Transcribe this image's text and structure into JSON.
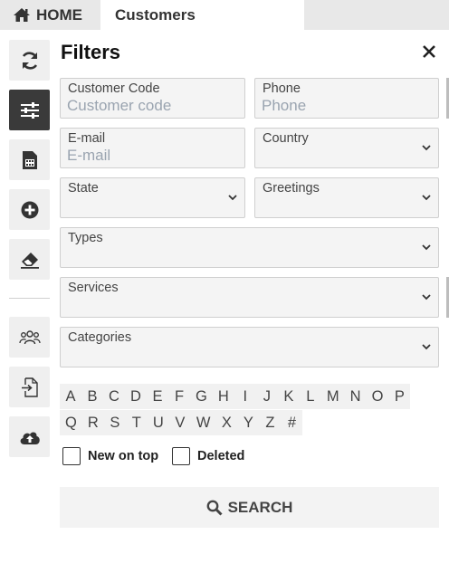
{
  "tabs": {
    "home_label": "HOME",
    "customers_label": "Customers"
  },
  "sidebar": {
    "buttons": [
      {
        "icon": "refresh-icon"
      },
      {
        "icon": "filter-sliders-icon",
        "active": true
      },
      {
        "icon": "calculator-document-icon"
      },
      {
        "icon": "add-circle-icon"
      },
      {
        "icon": "eraser-icon"
      },
      {
        "icon": "users-group-icon"
      },
      {
        "icon": "import-file-icon"
      },
      {
        "icon": "cloud-upload-icon"
      }
    ]
  },
  "filters": {
    "title": "Filters",
    "customer_code": {
      "label": "Customer Code",
      "placeholder": "Customer code",
      "value": ""
    },
    "phone": {
      "label": "Phone",
      "placeholder": "Phone",
      "value": ""
    },
    "email": {
      "label": "E-mail",
      "placeholder": "E-mail",
      "value": ""
    },
    "country": {
      "label": "Country",
      "value": ""
    },
    "state": {
      "label": "State",
      "value": ""
    },
    "greetings": {
      "label": "Greetings",
      "value": ""
    },
    "types": {
      "label": "Types",
      "value": ""
    },
    "services": {
      "label": "Services",
      "value": ""
    },
    "categories": {
      "label": "Categories",
      "value": ""
    }
  },
  "alphabet": {
    "row1": [
      "A",
      "B",
      "C",
      "D",
      "E",
      "F",
      "G",
      "H",
      "I",
      "J",
      "K",
      "L",
      "M",
      "N",
      "O",
      "P"
    ],
    "row2": [
      "Q",
      "R",
      "S",
      "T",
      "U",
      "V",
      "W",
      "X",
      "Y",
      "Z",
      "#"
    ]
  },
  "options": {
    "new_on_top": {
      "label": "New on top",
      "checked": false
    },
    "deleted": {
      "label": "Deleted",
      "checked": false
    }
  },
  "search_button_label": "SEARCH",
  "colors": {
    "accent_dark": "#3a3a3a",
    "field_bg": "#f4f4f4",
    "placeholder": "#9aa4b0"
  }
}
